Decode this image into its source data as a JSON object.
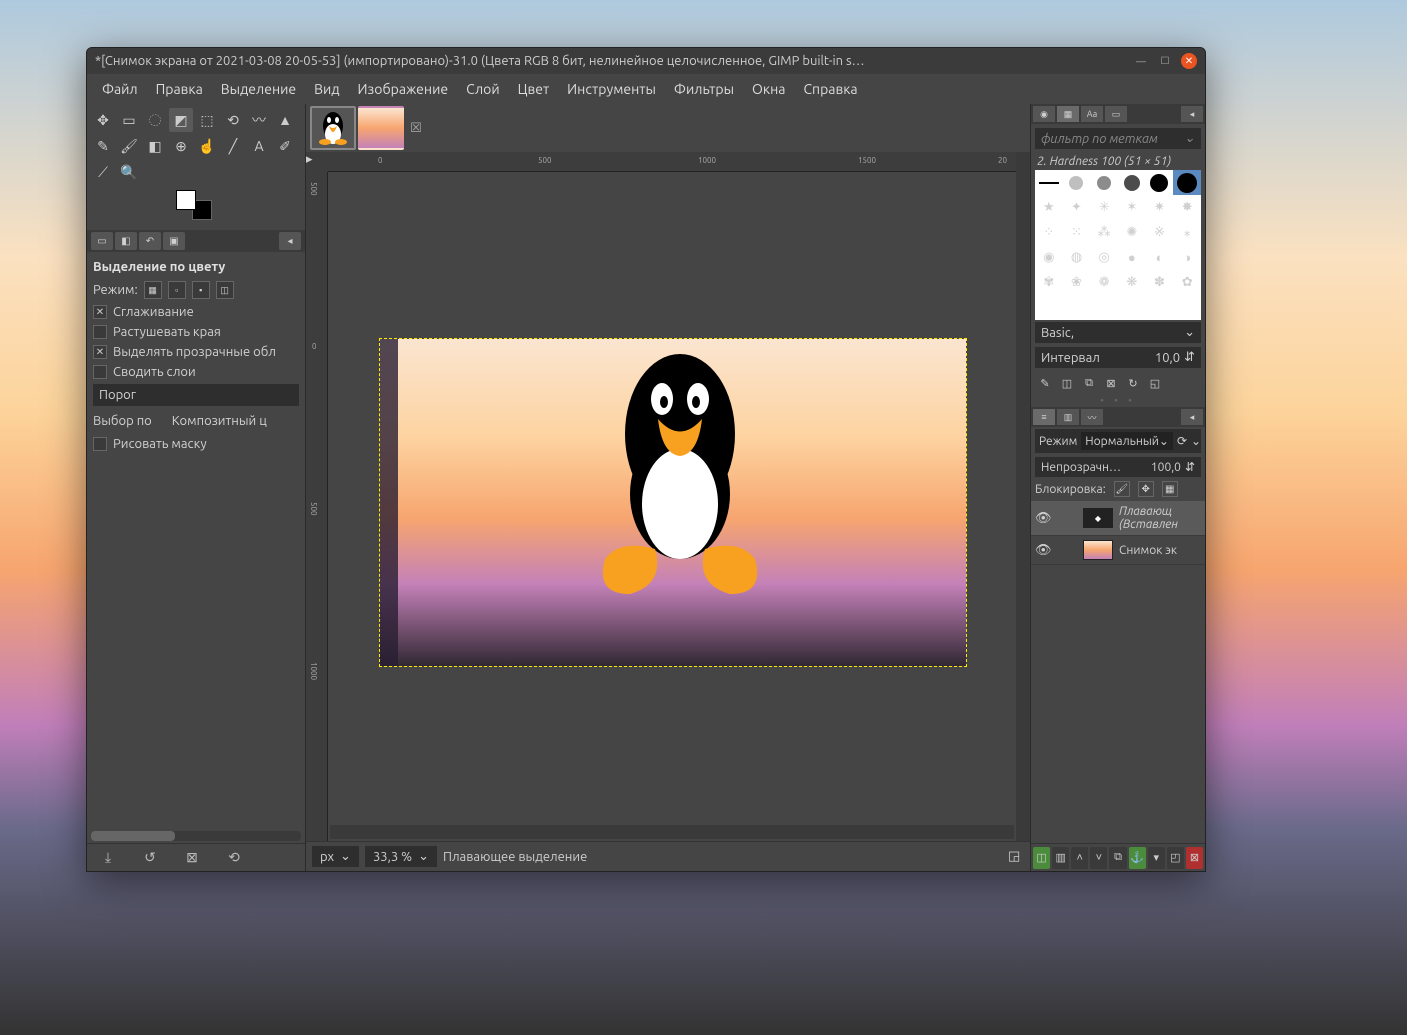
{
  "window": {
    "title": "*[Снимок экрана от 2021-03-08 20-05-53] (импортировано)-31.0 (Цвета RGB 8 бит, нелинейное целочисленное, GIMP built-in s…"
  },
  "menu": [
    "Файл",
    "Правка",
    "Выделение",
    "Вид",
    "Изображение",
    "Слой",
    "Цвет",
    "Инструменты",
    "Фильтры",
    "Окна",
    "Справка"
  ],
  "tooloptions": {
    "title": "Выделение по цвету",
    "mode_label": "Режим:",
    "opt_antialias": "Сглаживание",
    "opt_feather": "Растушевать края",
    "opt_transparent": "Выделять прозрачные обл",
    "opt_flatten": "Сводить слои",
    "threshold": "Порог",
    "selectby": "Выбор по",
    "composite": "Композитный ц",
    "drawmask": "Рисовать маску"
  },
  "right": {
    "tag_filter": "фильтр по меткам",
    "brush_label": "2. Hardness 100 (51 × 51)",
    "preset": "Basic,",
    "spacing_label": "Интервал",
    "spacing_value": "10,0",
    "mode_label": "Режим",
    "mode_value": "Нормальный",
    "opacity_label": "Непрозрачн…",
    "opacity_value": "100,0",
    "lock_label": "Блокировка:"
  },
  "layers": [
    {
      "name": "Плавающ",
      "sub": "(Вставлен",
      "italic": true,
      "thumb": "float"
    },
    {
      "name": "Снимок эк",
      "italic": false,
      "thumb": "bg"
    }
  ],
  "ruler": {
    "h": [
      "0",
      "500",
      "1000",
      "1500",
      "20"
    ],
    "v": [
      "500",
      "0",
      "500",
      "1000"
    ]
  },
  "status": {
    "unit": "px",
    "zoom": "33,3 %",
    "message": "Плавающее выделение"
  }
}
